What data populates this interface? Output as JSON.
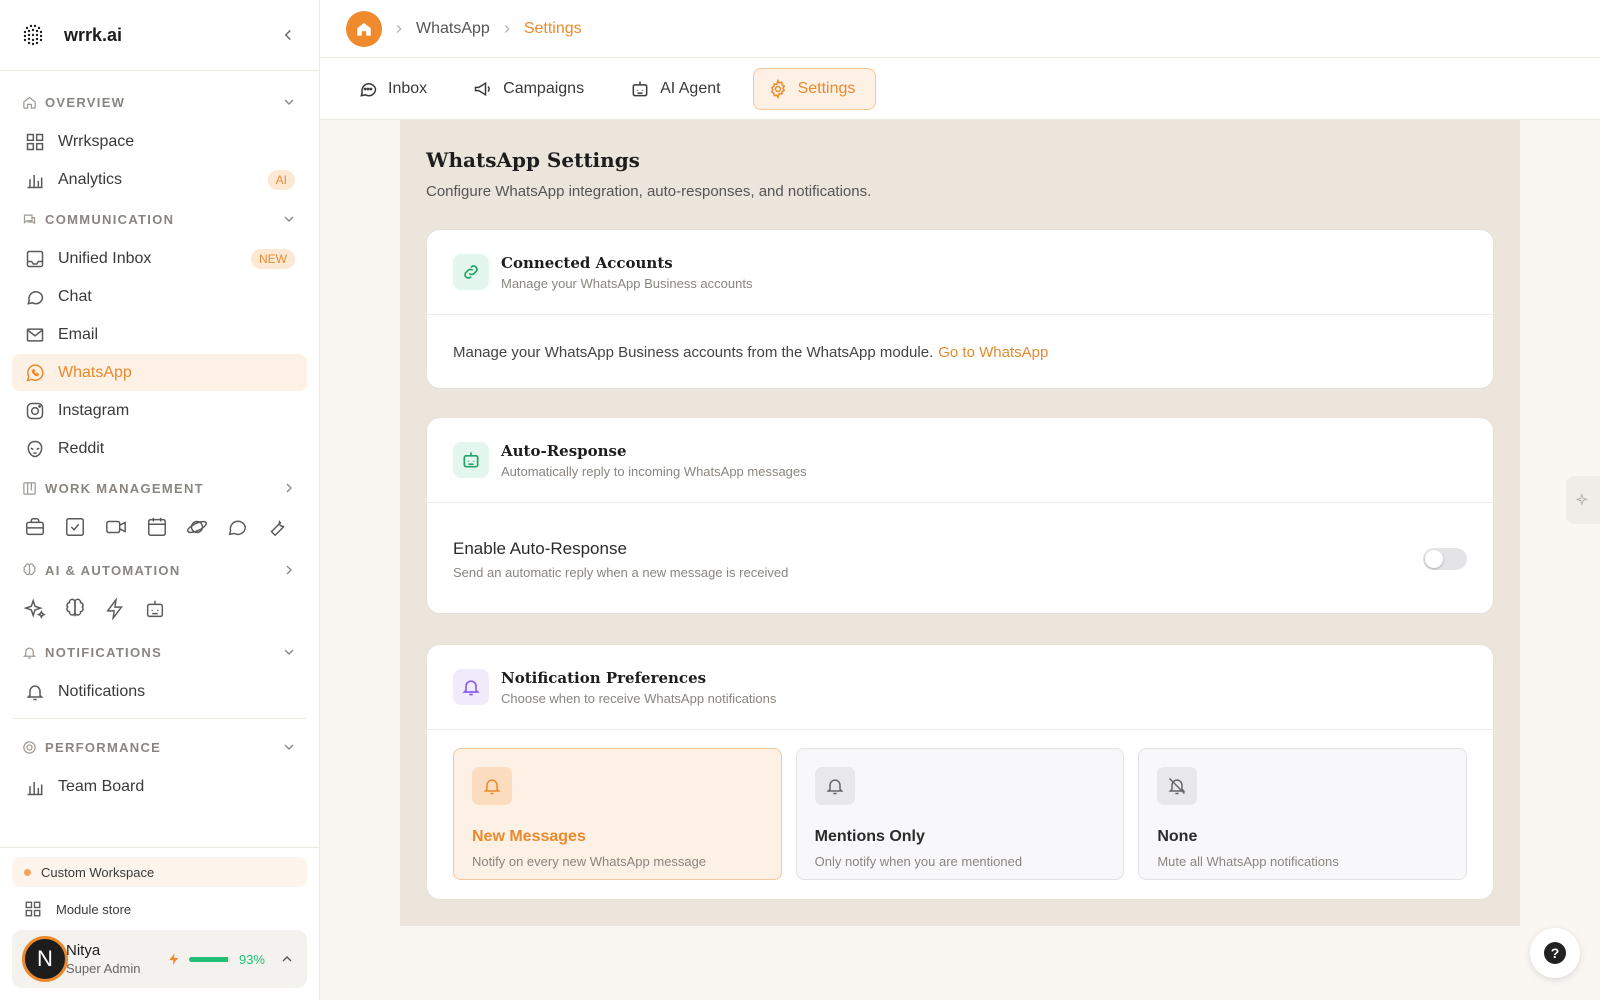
{
  "sidebar": {
    "brand": "wrrk.ai",
    "sections": {
      "overview": "OVERVIEW",
      "communication": "COMMUNICATION",
      "work_management": "WORK MANAGEMENT",
      "ai_automation": "AI & AUTOMATION",
      "notifications": "NOTIFICATIONS",
      "performance": "PERFORMANCE"
    },
    "items": {
      "wrrkspace": "Wrrkspace",
      "analytics": "Analytics",
      "analytics_badge": "AI",
      "unified_inbox": "Unified Inbox",
      "unified_inbox_badge": "NEW",
      "chat": "Chat",
      "email": "Email",
      "whatsapp": "WhatsApp",
      "instagram": "Instagram",
      "reddit": "Reddit",
      "notifications": "Notifications",
      "team_board": "Team Board"
    },
    "work_icons": [
      "briefcase-icon",
      "checkbox-icon",
      "video-icon",
      "calendar-icon",
      "planet-icon",
      "chat-bubble-icon",
      "wrench-icon"
    ],
    "ai_icons": [
      "sparkles-icon",
      "brain-icon",
      "bolt-icon",
      "bot-icon"
    ],
    "custom_workspace": "Custom Workspace",
    "module_store": "Module store",
    "user": {
      "initial": "N",
      "name": "Nitya",
      "role": "Super Admin",
      "energy_percent": 93,
      "energy_label": "93%"
    }
  },
  "breadcrumb": {
    "items": [
      "WhatsApp",
      "Settings"
    ]
  },
  "tabs": {
    "inbox": "Inbox",
    "campaigns": "Campaigns",
    "ai_agent": "AI Agent",
    "settings": "Settings"
  },
  "page": {
    "title": "WhatsApp Settings",
    "subtitle": "Configure WhatsApp integration, auto-responses, and notifications."
  },
  "connected_accounts": {
    "title": "Connected Accounts",
    "subtitle": "Manage your WhatsApp Business accounts",
    "body": "Manage your WhatsApp Business accounts from the WhatsApp module.",
    "link": "Go to WhatsApp"
  },
  "auto_response": {
    "title": "Auto-Response",
    "subtitle": "Automatically reply to incoming WhatsApp messages",
    "enable_title": "Enable Auto-Response",
    "enable_sub": "Send an automatic reply when a new message is received",
    "enabled": false
  },
  "notification_prefs": {
    "title": "Notification Preferences",
    "subtitle": "Choose when to receive WhatsApp notifications",
    "options": [
      {
        "title": "New Messages",
        "sub": "Notify on every new WhatsApp message",
        "selected": true
      },
      {
        "title": "Mentions Only",
        "sub": "Only notify when you are mentioned",
        "selected": false
      },
      {
        "title": "None",
        "sub": "Mute all WhatsApp notifications",
        "selected": false
      }
    ]
  },
  "colors": {
    "accent": "#ea8a2c",
    "accent_bg": "#fdf1e6",
    "success": "#1fbf75",
    "main_bg": "#ece5dc"
  },
  "floating": {
    "help": "?"
  }
}
